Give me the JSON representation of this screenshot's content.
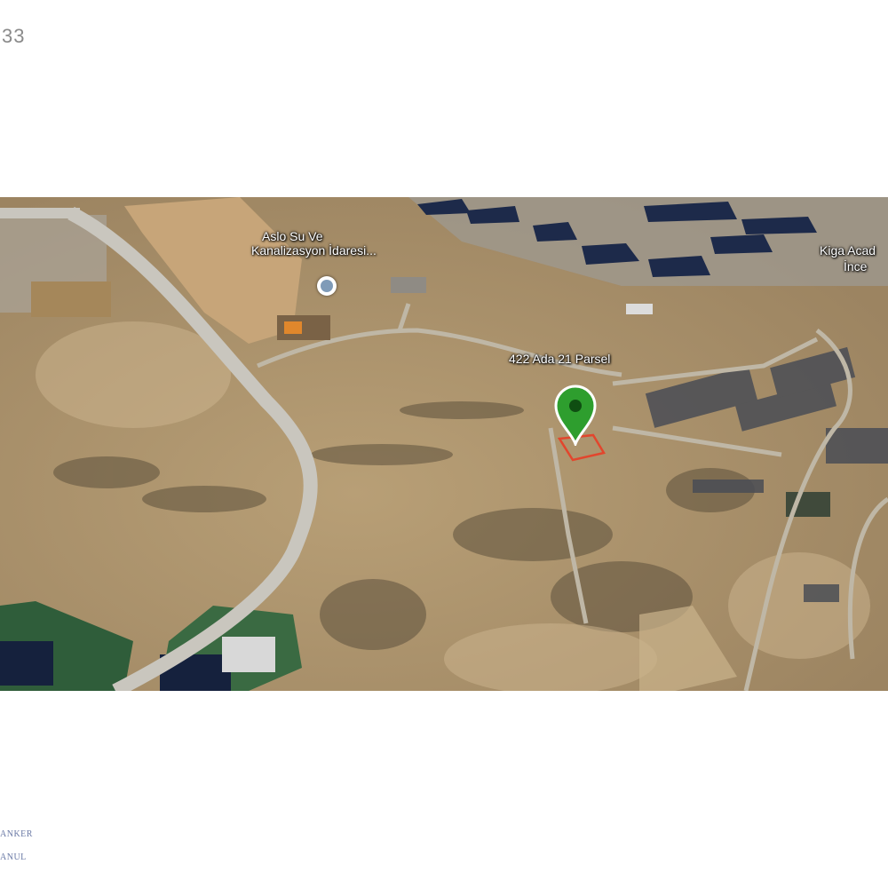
{
  "corner_number": "33",
  "map": {
    "poi_label_line1": "Aslo Su Ve",
    "poi_label_line2": "Kanalizasyon İdaresi...",
    "poi_icon": "building-icon",
    "parcel_label": "422 Ada 21 Parsel",
    "right_label_line1": "Kiga Acad",
    "right_label_line2": "İnce",
    "pin_color": "#2e9e2e",
    "parcel_outline_color": "#e2462d"
  },
  "footer": {
    "brand_line1": "ANKER",
    "brand_line2": "ANUL"
  }
}
